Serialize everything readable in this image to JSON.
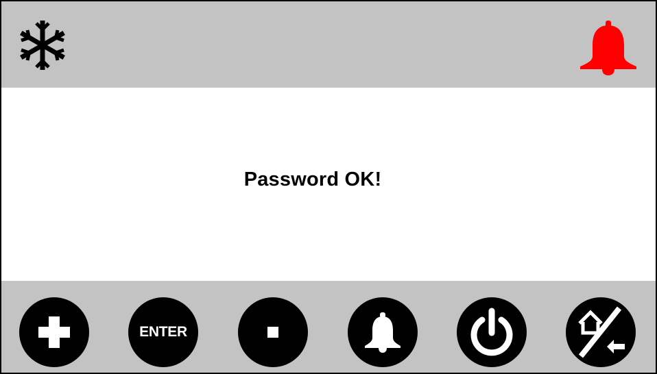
{
  "header": {
    "left_icon": "snowflake-icon",
    "right_icon": "bell-icon",
    "alarm_color": "#ff0000"
  },
  "main": {
    "message": "Password OK!"
  },
  "footer": {
    "buttons": [
      {
        "icon": "plus-icon"
      },
      {
        "label": "ENTER"
      },
      {
        "icon": "minus-icon"
      },
      {
        "icon": "bell-icon"
      },
      {
        "icon": "power-icon"
      },
      {
        "icon": "home-back-icon"
      }
    ]
  },
  "colors": {
    "bar": "#c3c3c3",
    "background": "#ffffff",
    "button": "#000000",
    "text": "#000000"
  }
}
